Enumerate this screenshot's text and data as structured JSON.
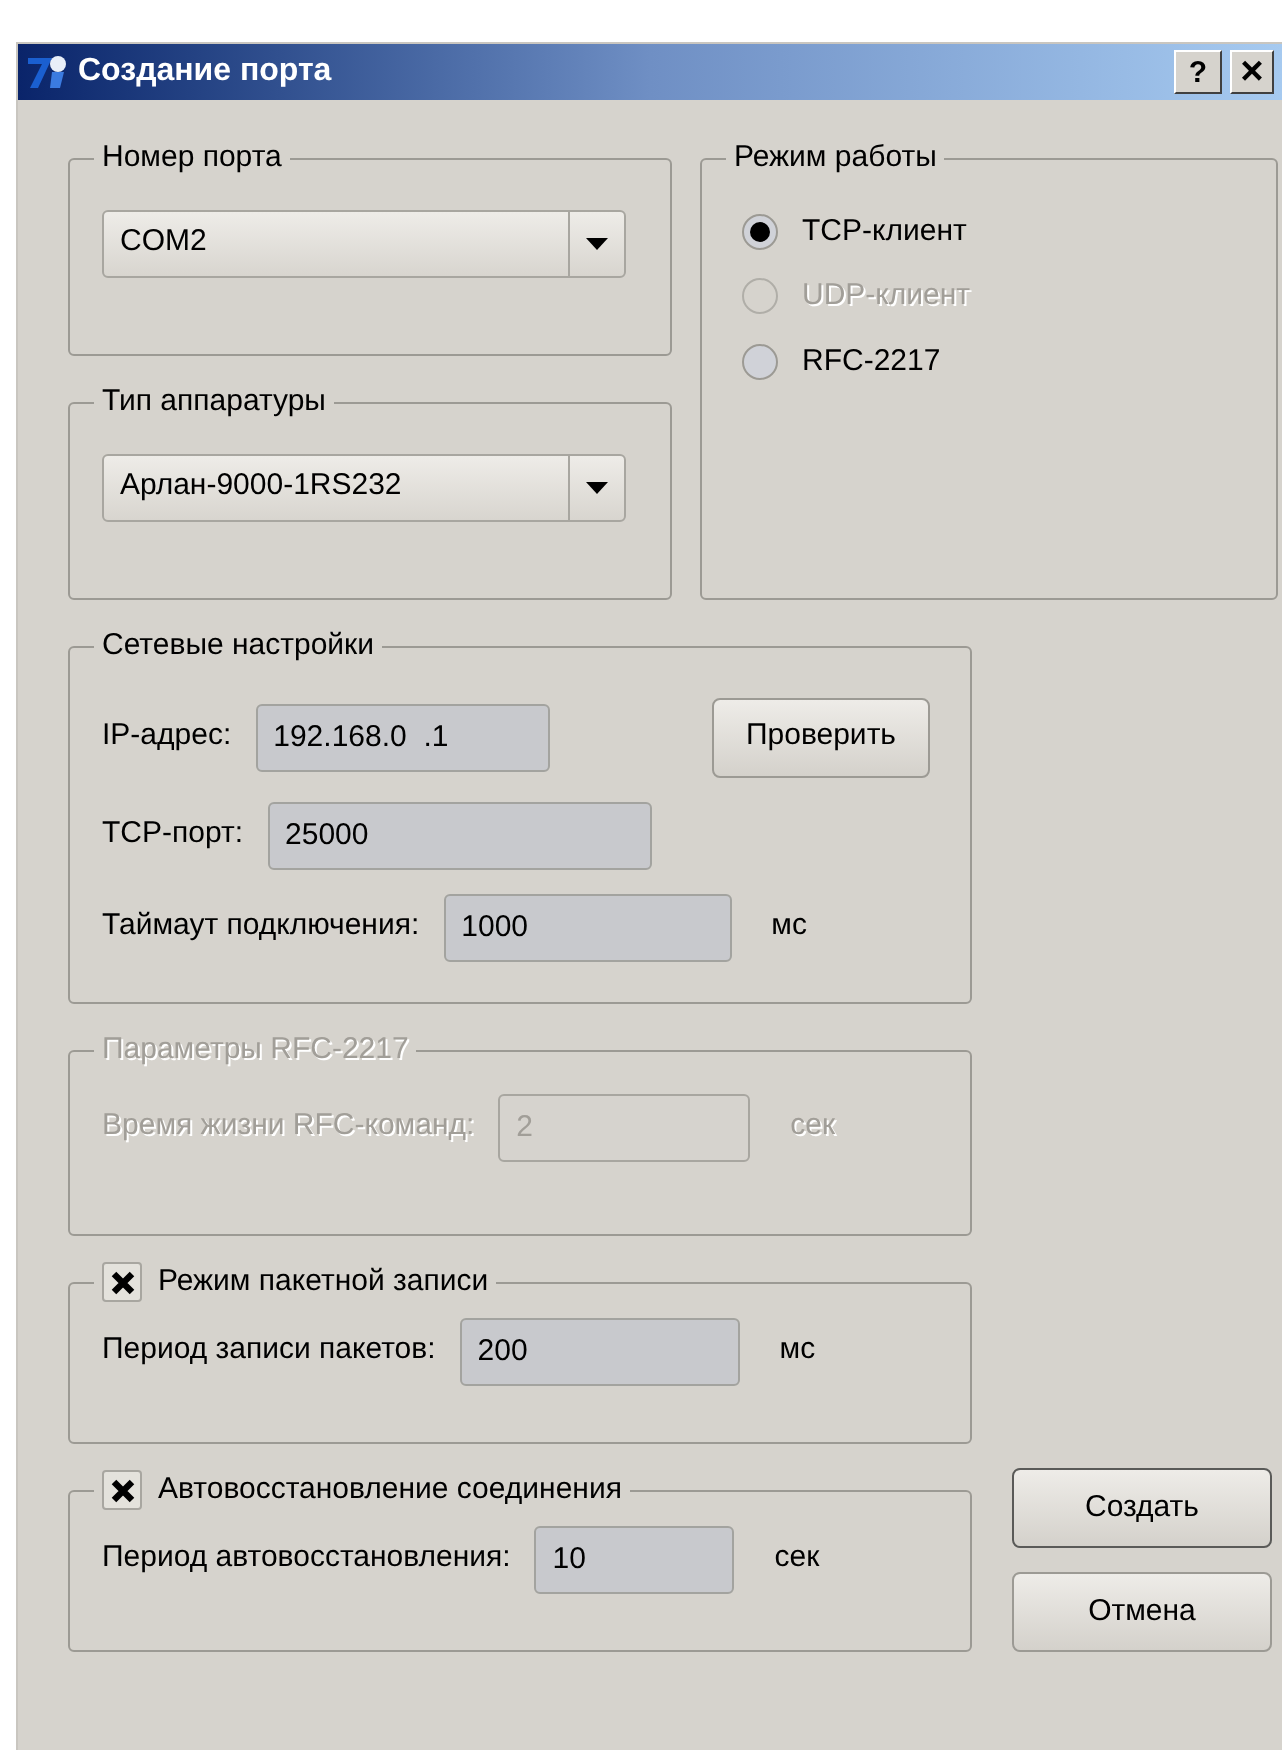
{
  "window": {
    "title": "Создание порта",
    "help_button": "?",
    "close_button": "×"
  },
  "port_number": {
    "label": "Номер порта",
    "value": "COM2"
  },
  "hardware_type": {
    "label": "Тип аппаратуры",
    "value": "Арлан-9000-1RS232"
  },
  "mode": {
    "label": "Режим работы",
    "options": [
      {
        "label": "TCP-клиент",
        "selected": true,
        "disabled": false
      },
      {
        "label": "UDP-клиент",
        "selected": false,
        "disabled": true
      },
      {
        "label": "RFC-2217",
        "selected": false,
        "disabled": false
      }
    ]
  },
  "network": {
    "label": "Сетевые настройки",
    "ip_address": {
      "label": "IP-адрес:",
      "value": "192.168.0  .1"
    },
    "check_button": "Проверить",
    "tcp_port": {
      "label": "TCP-порт:",
      "value": "25000"
    },
    "timeout": {
      "label": "Таймаут подключения:",
      "value": "1000",
      "unit": "мс"
    }
  },
  "rfc": {
    "label": "Параметры RFC-2217",
    "disabled": true,
    "field": {
      "label": "Время жизни RFC-команд:",
      "value": "2",
      "unit": "сек"
    }
  },
  "packet_mode": {
    "label": "Режим пакетной записи",
    "checked": true,
    "field": {
      "label": "Период записи пакетов:",
      "value": "200",
      "unit": "мс"
    }
  },
  "auto_reconnect": {
    "label": "Автовосстановление соединения",
    "checked": true,
    "field": {
      "label": "Период автовосстановления:",
      "value": "10",
      "unit": "сек"
    }
  },
  "buttons": [
    "Создать",
    "Отмена"
  ]
}
